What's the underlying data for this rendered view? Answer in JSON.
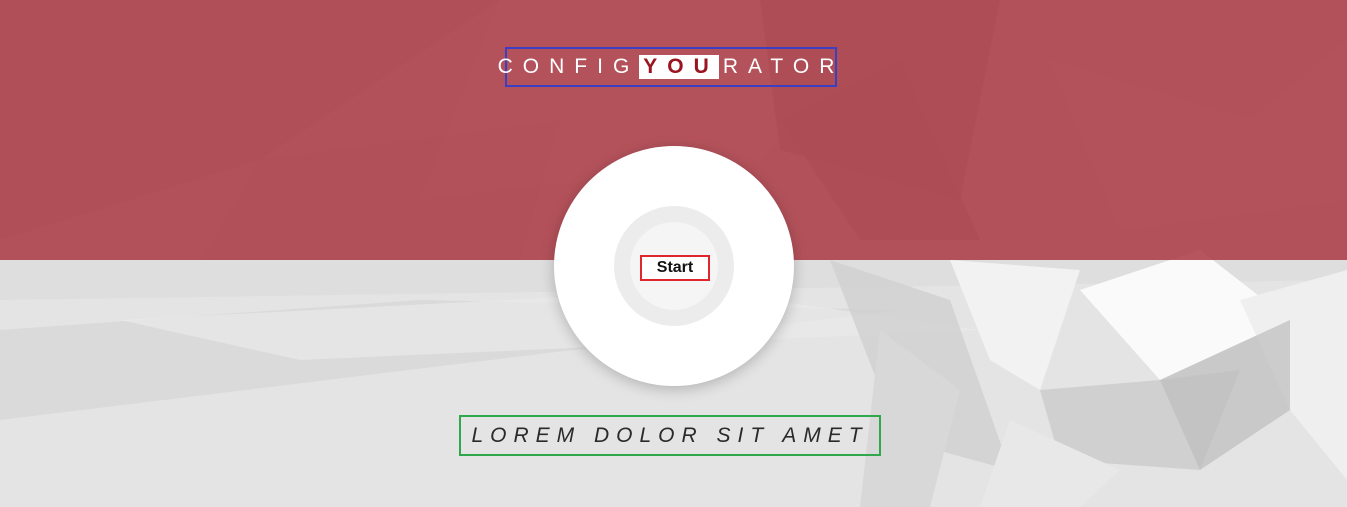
{
  "header": {
    "title_prefix": "CONFIG",
    "title_highlight": "YOU",
    "title_suffix": "RATOR"
  },
  "hero": {
    "start_label": "Start",
    "tagline": "LOREM DOLOR SIT AMET"
  },
  "colors": {
    "red_band": "#ad3e48",
    "highlight_text": "#9a1520",
    "title_border": "#3a3fc4",
    "start_border": "#e0262d",
    "tagline_border": "#2ea84a"
  }
}
